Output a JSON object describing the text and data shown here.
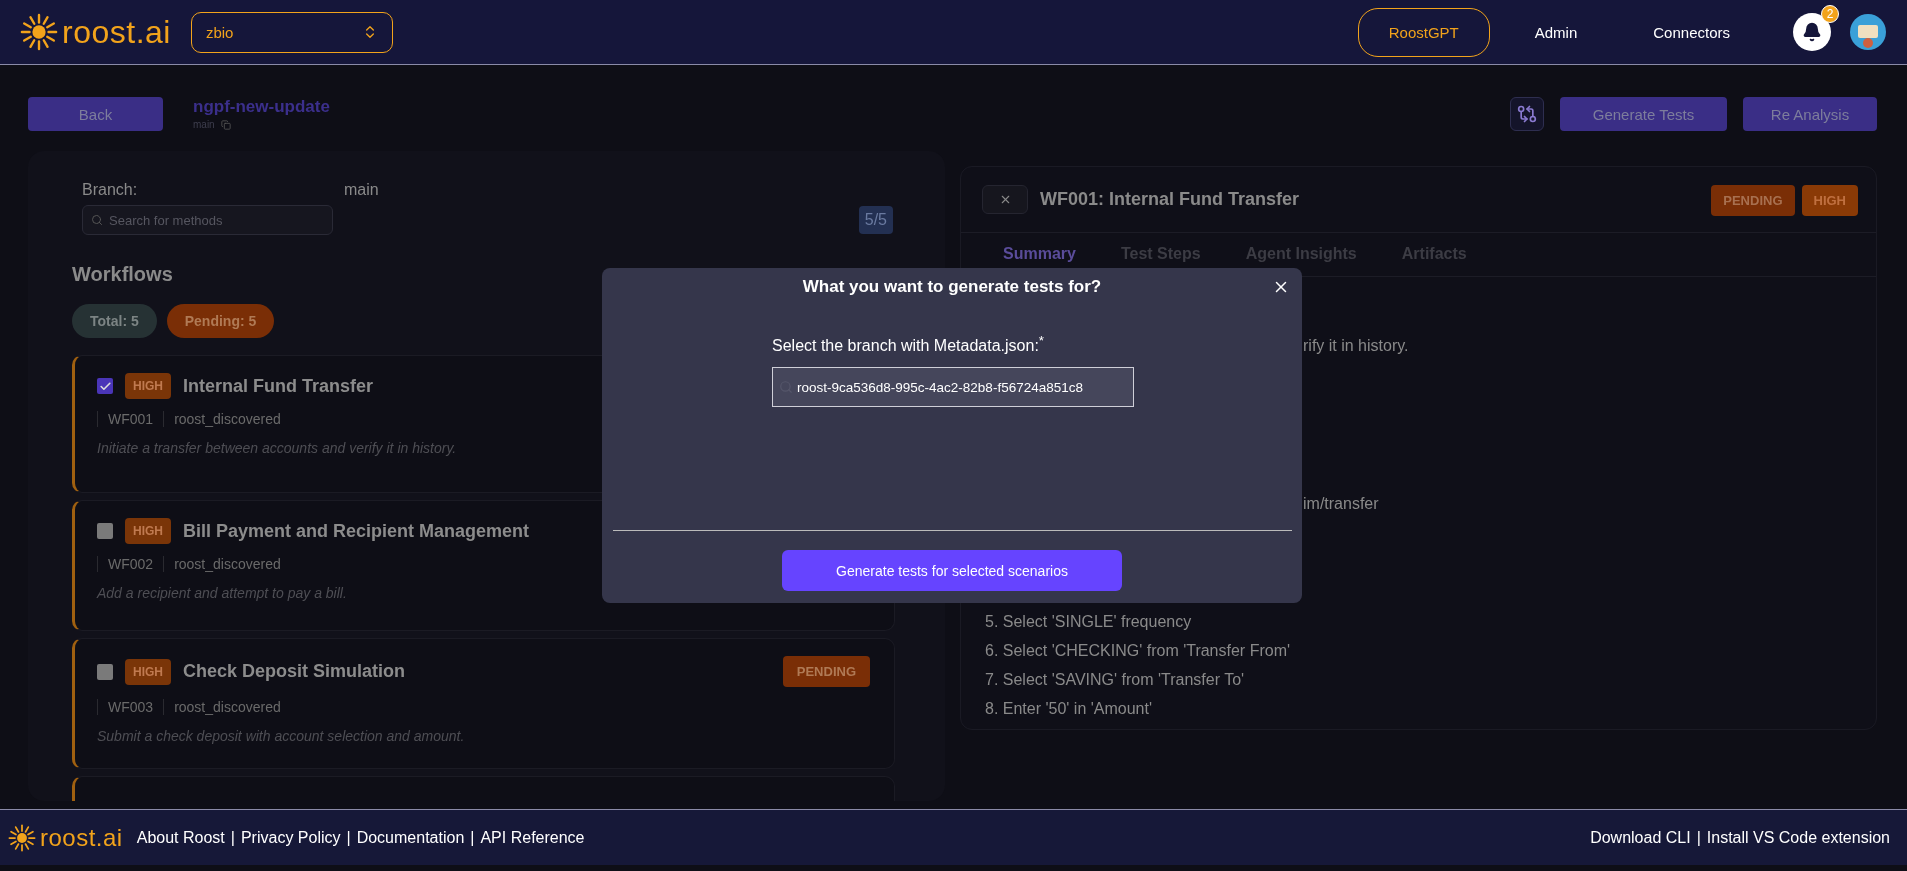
{
  "header": {
    "logo": "roost.ai",
    "org_select": {
      "value": "zbio"
    },
    "nav": [
      {
        "label": "RoostGPT",
        "selected": true
      },
      {
        "label": "Admin",
        "selected": false
      },
      {
        "label": "Connectors",
        "selected": false
      }
    ],
    "notification_count": "2"
  },
  "toolbar": {
    "back": "Back",
    "project": "ngpf-new-update",
    "branch": "main",
    "buttons": [
      "Generate Tests",
      "Re Analysis"
    ]
  },
  "left_panel": {
    "branch_label": "Branch:",
    "branch_value": "main",
    "search": {
      "placeholder": "Search for methods"
    },
    "counter": "5/5",
    "heading": "Workflows",
    "chips": [
      {
        "label": "Total: 5",
        "kind": "total"
      },
      {
        "label": "Pending: 5",
        "kind": "pending"
      }
    ],
    "workflows": [
      {
        "kind": "card",
        "checked": true,
        "priority": "HIGH",
        "title": "Internal Fund Transfer",
        "id": "WF001",
        "source": "roost_discovered",
        "description": "Initiate a transfer between accounts and verify it in history."
      },
      {
        "kind": "card",
        "checked": false,
        "priority": "HIGH",
        "title": "Bill Payment and Recipient Management",
        "id": "WF002",
        "source": "roost_discovered",
        "description": "Add a recipient and attempt to pay a bill."
      },
      {
        "kind": "card",
        "checked": false,
        "priority": "HIGH",
        "title": "Check Deposit Simulation",
        "id": "WF003",
        "source": "roost_discovered",
        "description": "Submit a check deposit with account selection and amount.",
        "status": "PENDING"
      },
      {
        "kind": "partial"
      }
    ]
  },
  "detail": {
    "title": "WF001: Internal Fund Transfer",
    "badges": [
      {
        "label": "PENDING",
        "kind": "status"
      },
      {
        "label": "HIGH",
        "kind": "priority"
      }
    ],
    "tabs": [
      {
        "label": "Summary",
        "selected": true
      },
      {
        "label": "Test Steps",
        "selected": false
      },
      {
        "label": "Agent Insights",
        "selected": false
      },
      {
        "label": "Artifacts",
        "selected": false
      }
    ],
    "description_fragment": "rify it in history.",
    "url_fragment": "im/transfer",
    "steps": [
      "5. Select 'SINGLE' frequency",
      "6. Select 'CHECKING' from 'Transfer From'",
      "7. Select 'SAVING' from 'Transfer To'",
      "8. Enter '50' in 'Amount'"
    ]
  },
  "modal": {
    "title": "What you want to generate tests for?",
    "label": "Select the branch with Metadata.json:$^{*}$",
    "branch_value": "roost-9ca536d8-995c-4ac2-82b8-f56724a851c8",
    "button": "Generate tests for selected scenarios"
  },
  "footer": {
    "logo": "roost.ai",
    "separator": "|",
    "links": [
      "About Roost",
      "Privacy Policy",
      "Documentation",
      "API Reference"
    ],
    "right_links": [
      "Download CLI",
      "Install VS Code extension"
    ]
  }
}
